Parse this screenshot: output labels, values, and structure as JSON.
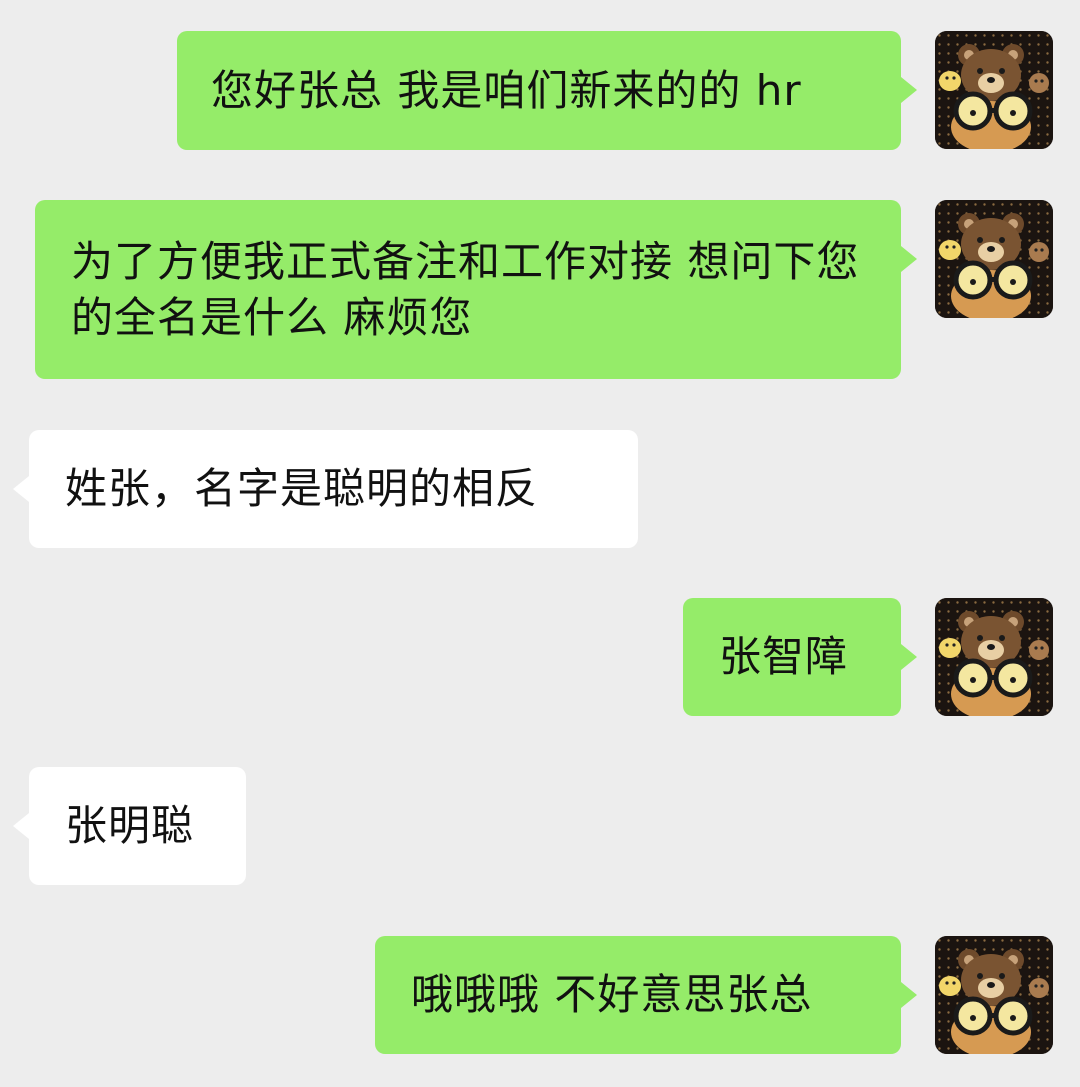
{
  "conversation": {
    "messages": [
      {
        "sender": "self",
        "text": "您好张总 我是咱们新来的的 hr"
      },
      {
        "sender": "self",
        "text": "为了方便我正式备注和工作对接 想问下您的全名是什么 麻烦您"
      },
      {
        "sender": "other",
        "text": "姓张，名字是聪明的相反"
      },
      {
        "sender": "self",
        "text": "张智障"
      },
      {
        "sender": "other",
        "text": "张明聪"
      },
      {
        "sender": "self",
        "text": "哦哦哦 不好意思张总"
      }
    ]
  },
  "avatar": {
    "icon": "bear-with-glasses-icon"
  },
  "colors": {
    "background": "#ededed",
    "self_bubble": "#95ec69",
    "other_bubble": "#ffffff",
    "text": "#111111"
  }
}
